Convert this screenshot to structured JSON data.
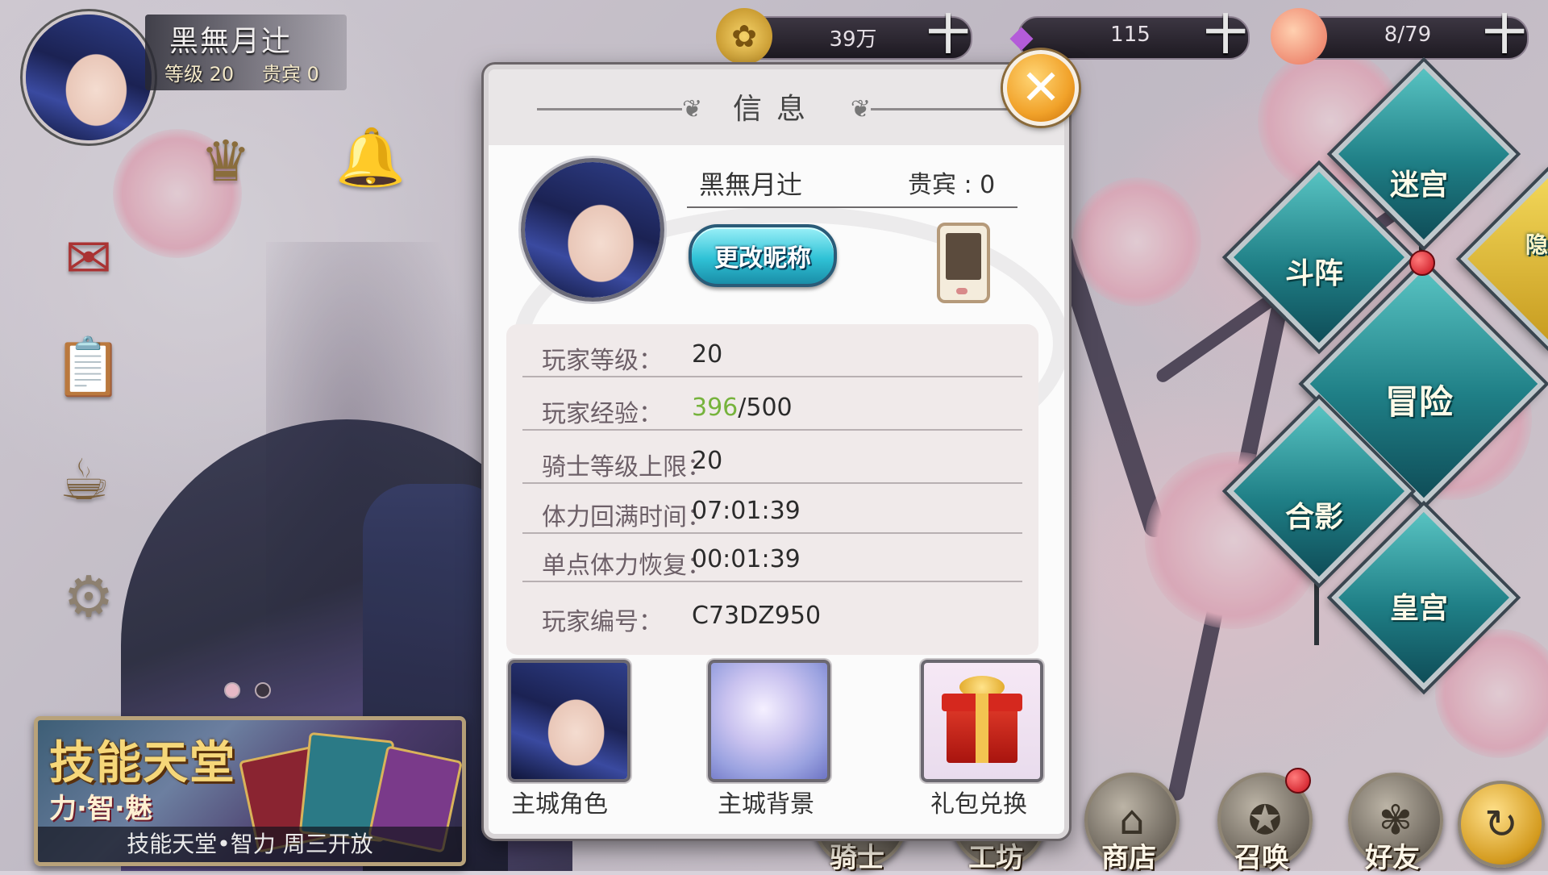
{
  "player": {
    "name": "黑無月辻",
    "level_label": "等级",
    "level": "20",
    "vip_label": "贵宾",
    "vip": "0"
  },
  "resources": [
    {
      "icon": "gold-coin-icon",
      "value": "39万",
      "plus": "十"
    },
    {
      "icon": "diamond-icon",
      "value": "115",
      "plus": "十"
    },
    {
      "icon": "peach-icon",
      "value": "8/79",
      "plus": "十"
    }
  ],
  "right_menu": {
    "maze": "迷宫",
    "arena": "斗阵",
    "adventure": "冒险",
    "photo": "合影",
    "palace": "皇宫",
    "hidden": "隐藏"
  },
  "bottom_nav": [
    "骑士",
    "工坊",
    "商店",
    "召唤",
    "好友"
  ],
  "banner": {
    "title": "技能天堂",
    "subtitle": "力·智·魅",
    "footer": "技能天堂•智力 周三开放"
  },
  "modal": {
    "title": "信息",
    "name": "黑無月辻",
    "vip_text": "贵宾 : 0",
    "rename_button": "更改昵称",
    "stats": [
      {
        "label": "玩家等级：",
        "value": "20"
      },
      {
        "label": "玩家经验：",
        "value_current": "396",
        "value_max": "/500"
      },
      {
        "label": "骑士等级上限：",
        "value": "20"
      },
      {
        "label": "体力回满时间：",
        "value": "07:01:39"
      },
      {
        "label": "单点体力恢复：",
        "value": "00:01:39"
      },
      {
        "label": "玩家编号：",
        "value": "C73DZ950"
      }
    ],
    "tiles": [
      {
        "label": "主城角色"
      },
      {
        "label": "主城背景"
      },
      {
        "label": "礼包兑换"
      }
    ],
    "close_glyph": "✕"
  },
  "colors": {
    "level_value": "#f28a1a",
    "exp_value": "#76b33c",
    "rename_button": "#2fc2d6",
    "close_button": "#f1a22a",
    "diamond_menu": "#1f7f86"
  }
}
